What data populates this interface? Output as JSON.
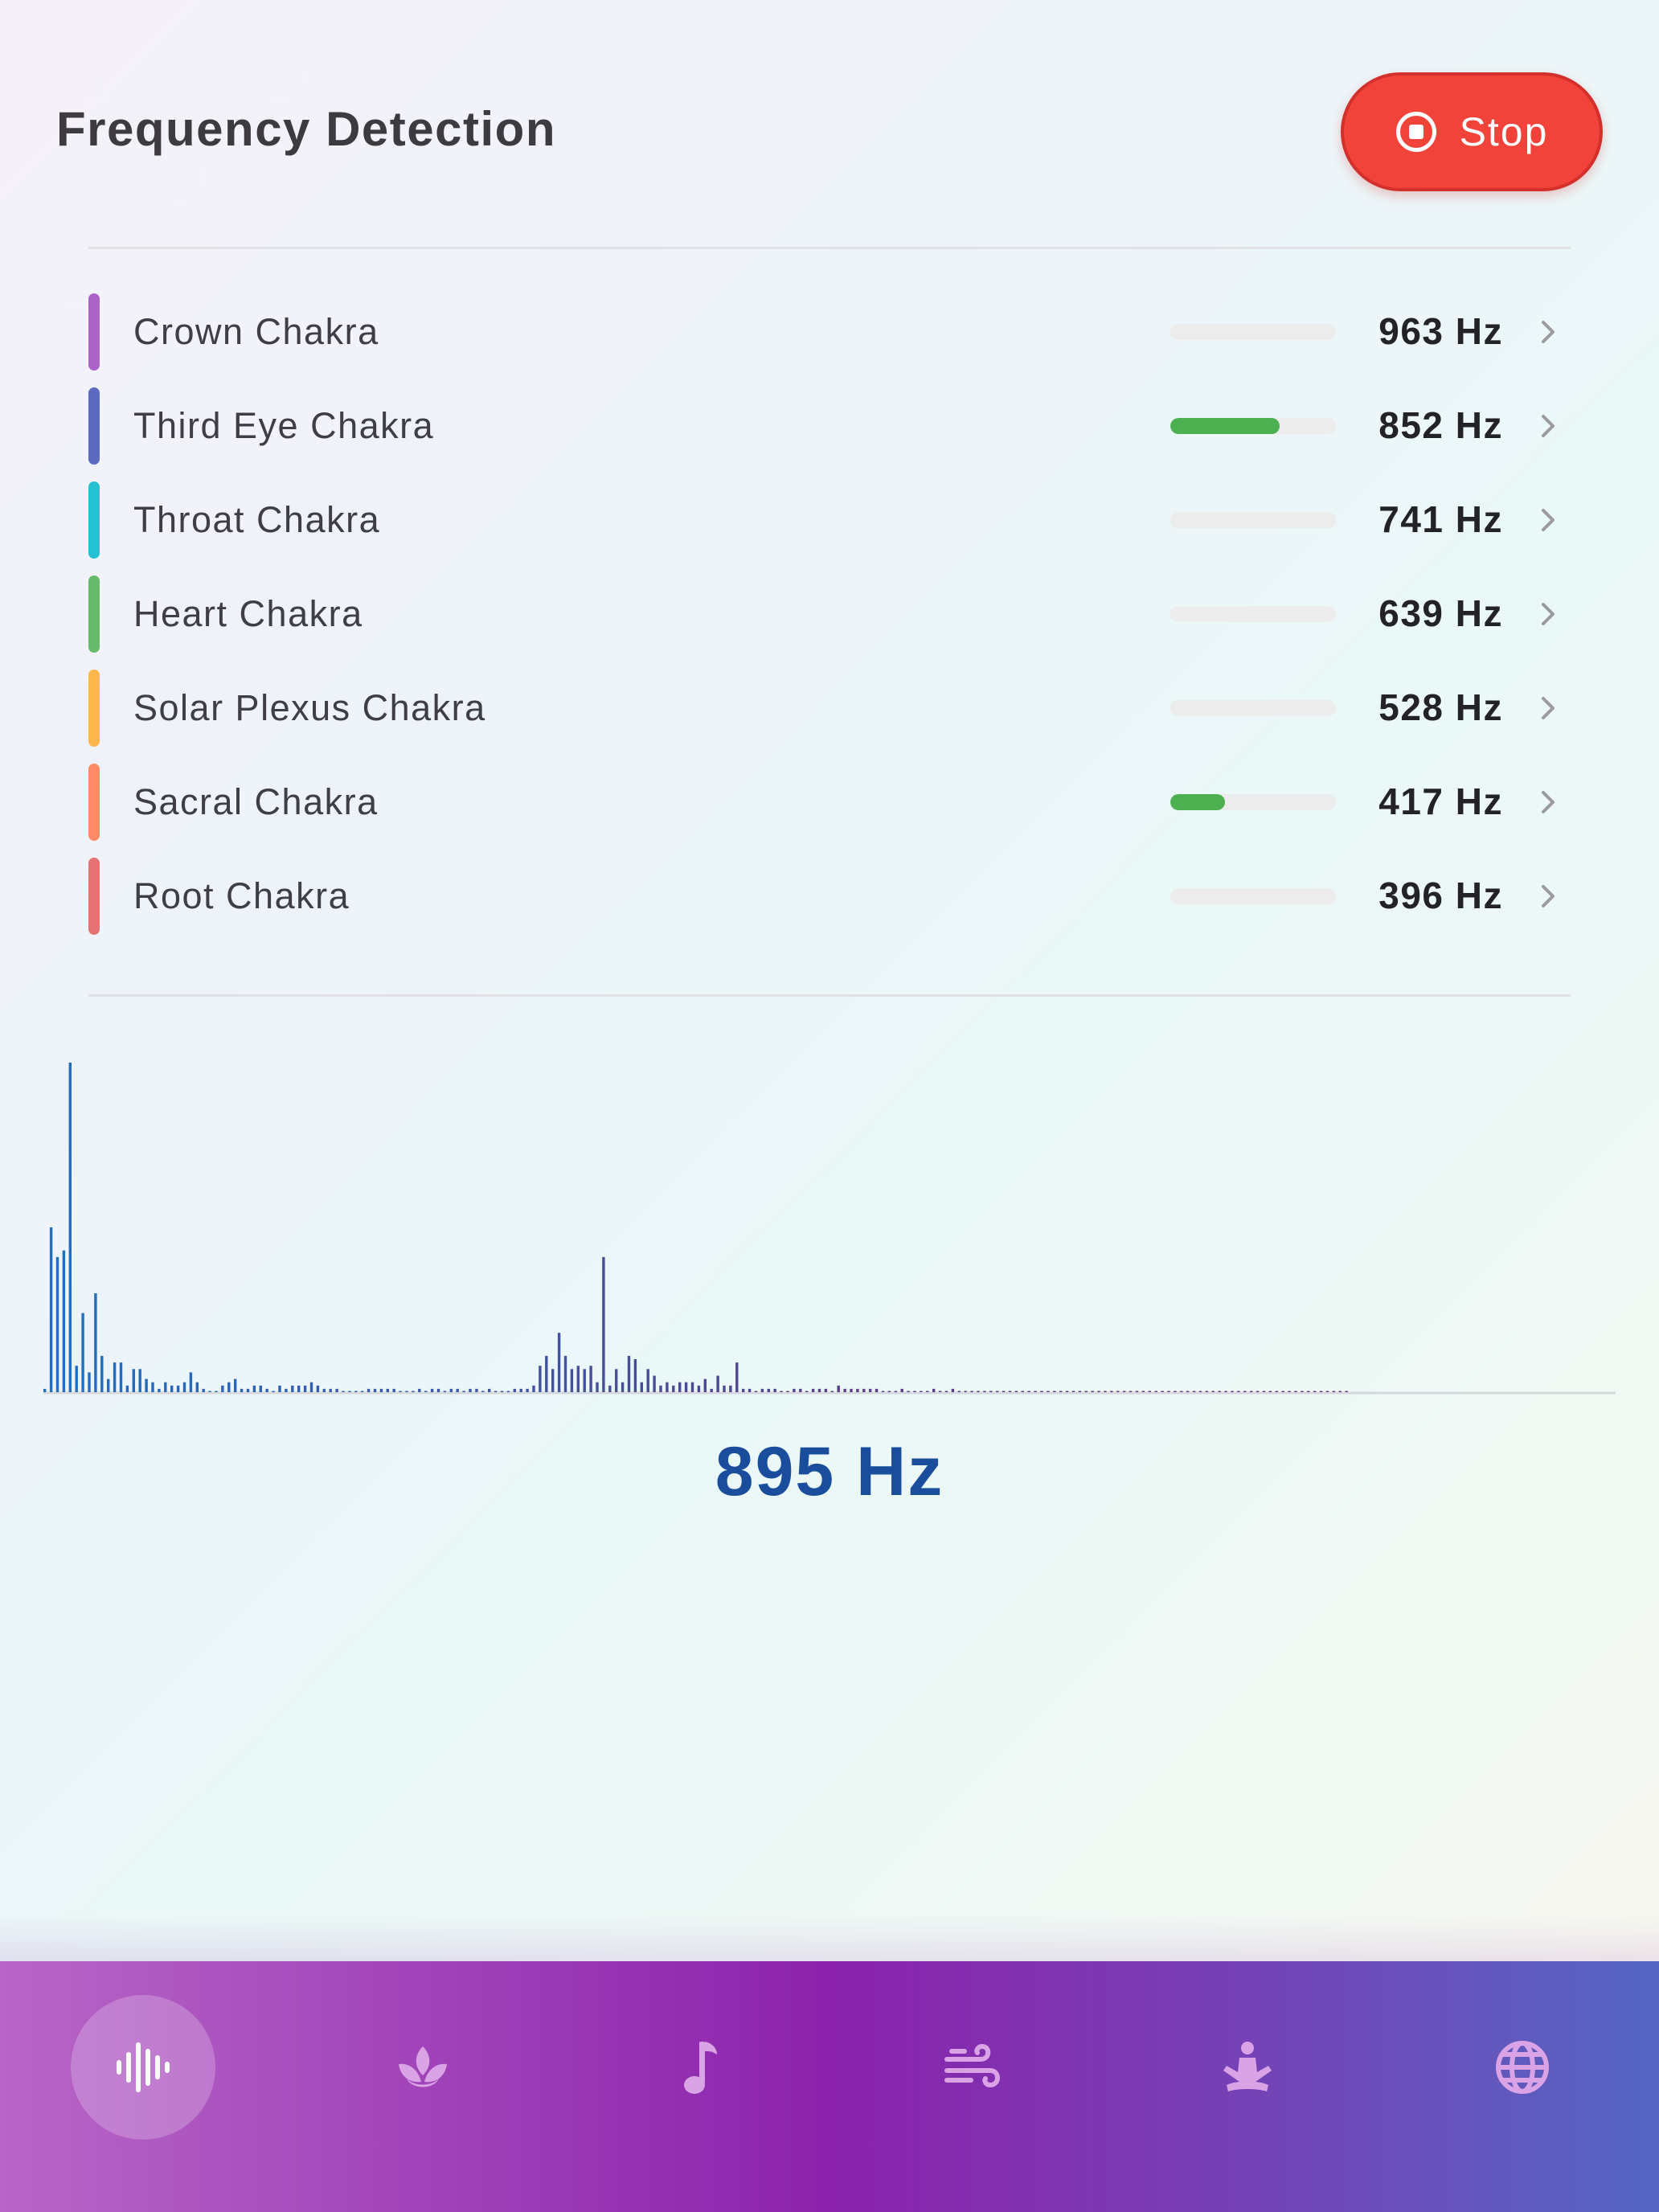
{
  "header": {
    "title": "Frequency Detection",
    "stop_label": "Stop",
    "stop_color": "#f2433a"
  },
  "chakras": [
    {
      "name": "Crown Chakra",
      "frequency": "963 Hz",
      "color": "#ab63c8",
      "level": 0.0
    },
    {
      "name": "Third Eye Chakra",
      "frequency": "852 Hz",
      "color": "#5c6bc0",
      "level": 0.66
    },
    {
      "name": "Throat Chakra",
      "frequency": "741 Hz",
      "color": "#26c0d3",
      "level": 0.0
    },
    {
      "name": "Heart Chakra",
      "frequency": "639 Hz",
      "color": "#66bb6a",
      "level": 0.0
    },
    {
      "name": "Solar Plexus Chakra",
      "frequency": "528 Hz",
      "color": "#ffb74d",
      "level": 0.0
    },
    {
      "name": "Sacral Chakra",
      "frequency": "417 Hz",
      "color": "#ff8a65",
      "level": 0.33
    },
    {
      "name": "Root Chakra",
      "frequency": "396 Hz",
      "color": "#e57373",
      "level": 0.0
    }
  ],
  "level_fill_color": "#4caf50",
  "dominant_frequency": "895 Hz",
  "spectrum": {
    "bar_color_start": "#1e6fc4",
    "bar_color_end": "#5a3f88",
    "magnitudes": [
      0.01,
      0.5,
      0.41,
      0.43,
      1.0,
      0.08,
      0.24,
      0.06,
      0.3,
      0.11,
      0.04,
      0.09,
      0.09,
      0.02,
      0.07,
      0.07,
      0.04,
      0.03,
      0.01,
      0.03,
      0.02,
      0.02,
      0.03,
      0.06,
      0.03,
      0.01,
      0.0,
      0.0,
      0.02,
      0.03,
      0.04,
      0.01,
      0.01,
      0.02,
      0.02,
      0.01,
      0.0,
      0.02,
      0.01,
      0.02,
      0.02,
      0.02,
      0.03,
      0.02,
      0.01,
      0.01,
      0.01,
      0.0,
      0.0,
      0.0,
      0.0,
      0.01,
      0.01,
      0.01,
      0.01,
      0.01,
      0.0,
      0.0,
      0.0,
      0.01,
      0.0,
      0.01,
      0.01,
      0.0,
      0.01,
      0.01,
      0.0,
      0.01,
      0.01,
      0.0,
      0.01,
      0.0,
      0.0,
      0.0,
      0.01,
      0.01,
      0.01,
      0.02,
      0.08,
      0.11,
      0.07,
      0.18,
      0.11,
      0.07,
      0.08,
      0.07,
      0.08,
      0.03,
      0.41,
      0.02,
      0.07,
      0.03,
      0.11,
      0.1,
      0.03,
      0.07,
      0.05,
      0.02,
      0.03,
      0.02,
      0.03,
      0.03,
      0.03,
      0.02,
      0.04,
      0.01,
      0.05,
      0.02,
      0.02,
      0.09,
      0.01,
      0.01,
      0.0,
      0.01,
      0.01,
      0.01,
      0.0,
      0.0,
      0.01,
      0.01,
      0.0,
      0.01,
      0.01,
      0.01,
      0.0,
      0.02,
      0.01,
      0.01,
      0.01,
      0.01,
      0.01,
      0.01,
      0.0,
      0.0,
      0.0,
      0.01,
      0.0,
      0.0,
      0.0,
      0.0,
      0.01,
      0.0,
      0.0,
      0.01,
      0.0,
      0.0,
      0.0,
      0.0,
      0.0,
      0.0,
      0.0,
      0.0,
      0.0,
      0.0,
      0.0,
      0.0,
      0.0,
      0.0,
      0.0,
      0.0,
      0.0,
      0.0,
      0.0,
      0.0,
      0.0,
      0.0,
      0.0,
      0.0,
      0.0,
      0.0,
      0.0,
      0.0,
      0.0,
      0.0,
      0.0,
      0.0,
      0.0,
      0.0,
      0.0,
      0.0,
      0.0,
      0.0,
      0.0,
      0.0,
      0.0,
      0.0,
      0.0,
      0.0,
      0.0,
      0.0,
      0.0,
      0.0,
      0.0,
      0.0,
      0.0,
      0.0,
      0.0,
      0.0,
      0.0,
      0.0,
      0.0,
      0.0,
      0.0,
      0.0,
      0.0,
      0.0
    ]
  },
  "tabs": [
    {
      "icon": "waveform-icon",
      "active": true
    },
    {
      "icon": "lotus-icon",
      "active": false
    },
    {
      "icon": "music-note-icon",
      "active": false
    },
    {
      "icon": "wind-icon",
      "active": false
    },
    {
      "icon": "meditation-icon",
      "active": false
    },
    {
      "icon": "globe-icon",
      "active": false
    }
  ]
}
